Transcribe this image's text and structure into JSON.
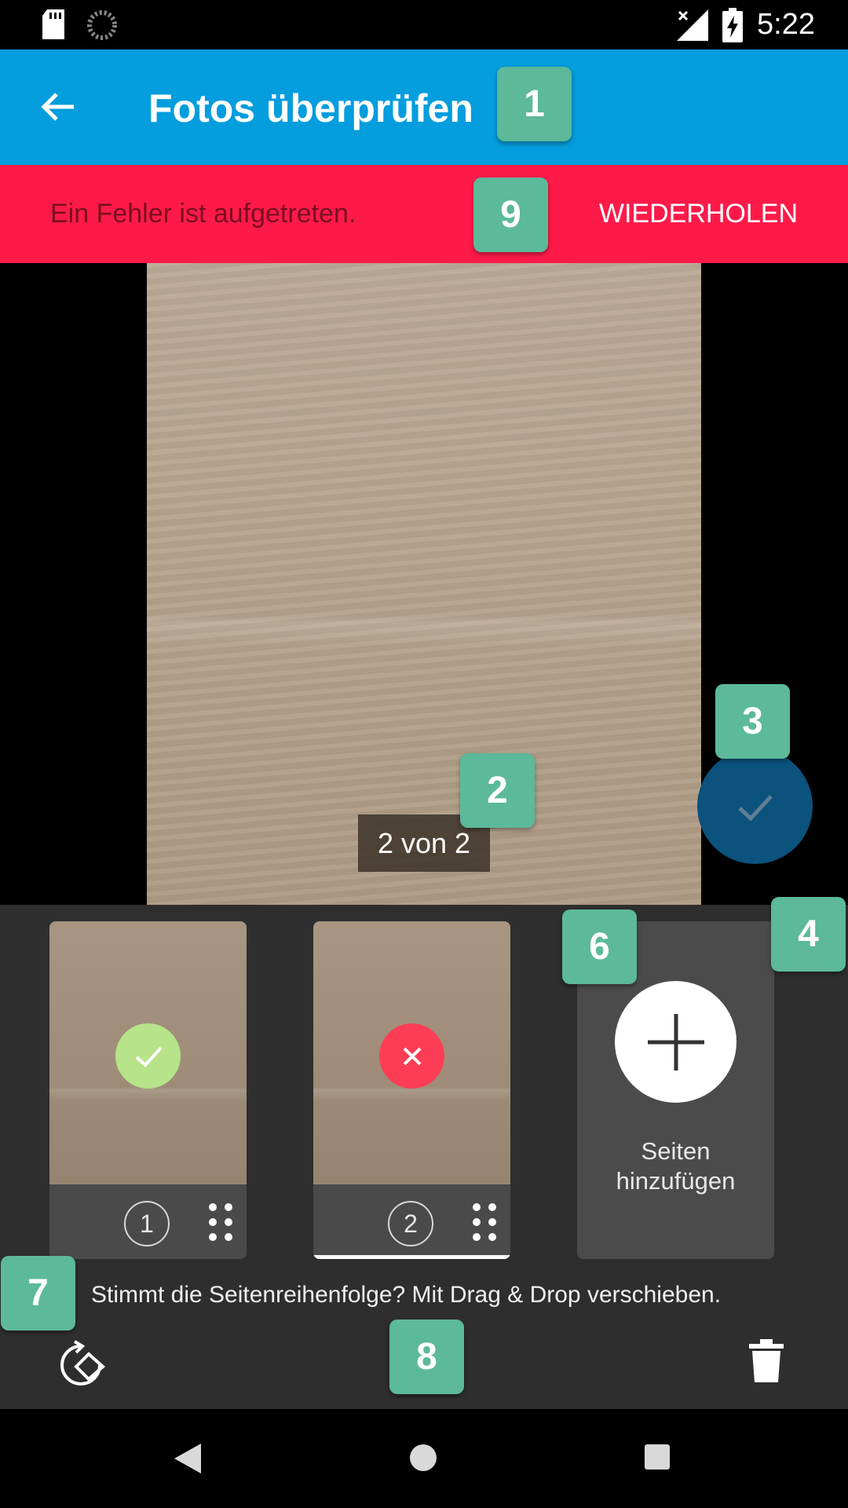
{
  "status_bar": {
    "time": "5:22",
    "icons": [
      "sd-card-icon",
      "sync-spinner-icon",
      "signal-off-icon",
      "battery-charging-icon"
    ]
  },
  "app_bar": {
    "title": "Fotos überprüfen",
    "back_icon": "arrow-left-icon"
  },
  "error_banner": {
    "message": "Ein Fehler ist aufgetreten.",
    "action_label": "WIEDERHOLEN"
  },
  "preview": {
    "counter": "2 von 2"
  },
  "confirm_fab": {
    "icon": "check-icon"
  },
  "pages": [
    {
      "number": "1",
      "status": "success",
      "status_color": "#b7e38a"
    },
    {
      "number": "2",
      "status": "error",
      "status_color": "#fd3d55",
      "selected": true
    }
  ],
  "add_pages": {
    "label_line1": "Seiten",
    "label_line2": "hinzufügen"
  },
  "hint": "Stimmt die Seitenreihenfolge? Mit Drag & Drop verschieben.",
  "toolbar": {
    "rotate_icon": "rotate-icon",
    "delete_icon": "trash-icon"
  },
  "annotations": [
    "1",
    "2",
    "3",
    "4",
    "6",
    "7",
    "8",
    "9"
  ],
  "colors": {
    "app_bar": "#049ddd",
    "error_banner": "#fd1a49",
    "fab": "#0b527d",
    "badge": "#5cb99a"
  }
}
